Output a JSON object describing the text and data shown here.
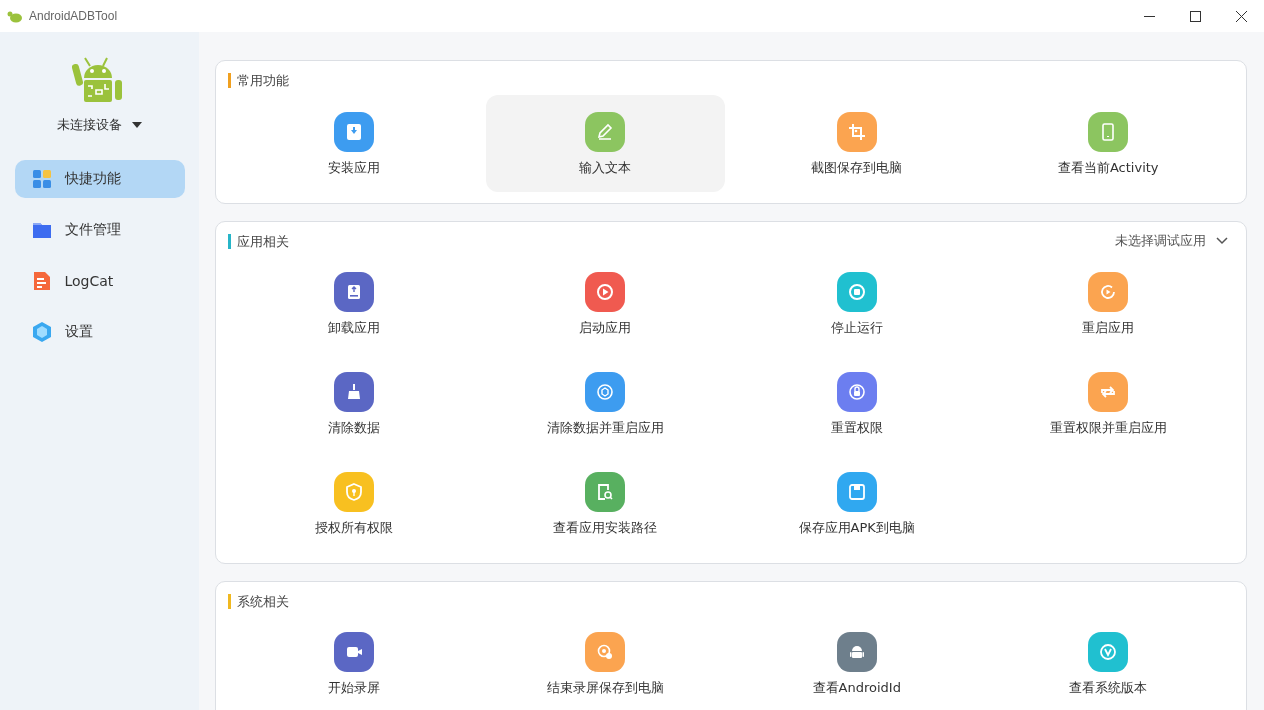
{
  "window": {
    "title": "AndroidADBTool"
  },
  "device": {
    "label": "未连接设备"
  },
  "sidebar": {
    "items": [
      {
        "label": "快捷功能",
        "kind": "grid",
        "selected": true
      },
      {
        "label": "文件管理",
        "kind": "folder",
        "selected": false
      },
      {
        "label": "LogCat",
        "kind": "doc",
        "selected": false
      },
      {
        "label": "设置",
        "kind": "hex",
        "selected": false
      }
    ]
  },
  "sections": [
    {
      "title": "常用功能",
      "color": "#f0a020",
      "items": [
        {
          "label": "安装应用",
          "kind": "install",
          "color": "#3d9cf0",
          "highlighted": false
        },
        {
          "label": "输入文本",
          "kind": "pencil",
          "color": "#8cc560",
          "highlighted": true
        },
        {
          "label": "截图保存到电脑",
          "kind": "crop",
          "color": "#fba450",
          "highlighted": false
        },
        {
          "label": "查看当前Activity",
          "kind": "tablet",
          "color": "#8cc560",
          "highlighted": false
        }
      ]
    },
    {
      "title": "应用相关",
      "color": "#27b5c8",
      "dropdown": "未选择调试应用",
      "items": [
        {
          "label": "卸载应用",
          "kind": "uninstall",
          "color": "#5b67c4"
        },
        {
          "label": "启动应用",
          "kind": "play",
          "color": "#f05a50"
        },
        {
          "label": "停止运行",
          "kind": "stop",
          "color": "#20c0d0"
        },
        {
          "label": "重启应用",
          "kind": "restart",
          "color": "#fba450"
        },
        {
          "label": "清除数据",
          "kind": "broom",
          "color": "#5b67c4"
        },
        {
          "label": "清除数据并重启应用",
          "kind": "cube",
          "color": "#3d9cf0"
        },
        {
          "label": "重置权限",
          "kind": "lock",
          "color": "#6c7ef0"
        },
        {
          "label": "重置权限并重启应用",
          "kind": "loop",
          "color": "#fba450"
        },
        {
          "label": "授权所有权限",
          "kind": "shield",
          "color": "#f8c020"
        },
        {
          "label": "查看应用安装路径",
          "kind": "filesearch",
          "color": "#58b060"
        },
        {
          "label": "保存应用APK到电脑",
          "kind": "save",
          "color": "#30a8f0"
        }
      ]
    },
    {
      "title": "系统相关",
      "color": "#f0b820",
      "items": [
        {
          "label": "开始录屏",
          "kind": "video",
          "color": "#5b67c4"
        },
        {
          "label": "结束录屏保存到电脑",
          "kind": "record",
          "color": "#fba450"
        },
        {
          "label": "查看AndroidId",
          "kind": "android",
          "color": "#6e7f8c"
        },
        {
          "label": "查看系统版本",
          "kind": "version",
          "color": "#20c0d0"
        }
      ]
    }
  ]
}
